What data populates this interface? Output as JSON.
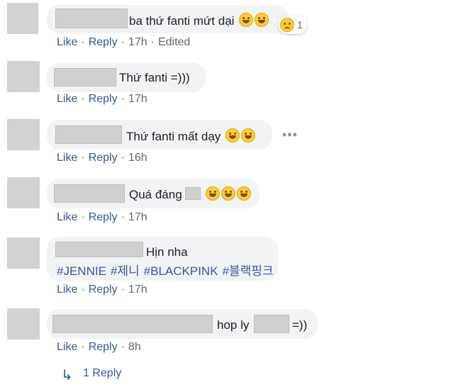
{
  "actions": {
    "like": "Like",
    "reply": "Reply",
    "sep": "·"
  },
  "comments": [
    {
      "text": "ba thứ fanti mứt dại",
      "time": "17h",
      "edited": "Edited",
      "reaction_count": "1"
    },
    {
      "text": "Thứ fanti =)))",
      "time": "17h"
    },
    {
      "text": "Thứ fanti mất dạy",
      "time": "16h"
    },
    {
      "text": "Quá đáng",
      "time": "17h"
    },
    {
      "text": "Hịn nha",
      "tags": [
        "#JENNIE",
        "#제니",
        "#BLACKPINK",
        "#블랙핑크"
      ],
      "time": "17h"
    },
    {
      "text": "hop ly",
      "text2": "=))",
      "time": "8h"
    }
  ],
  "reply_link": {
    "label": "1 Reply"
  },
  "icons": {
    "emoji_laugh": "rolling-on-floor-laughing-icon",
    "emoji_grin": "grinning-tears-icon",
    "reaction": "sad-icon",
    "more": "more-options-icon",
    "reply_arrow": "reply-arrow-icon"
  },
  "colors": {
    "link": "#385898",
    "bubble": "#f2f3f5",
    "meta": "#606770"
  }
}
